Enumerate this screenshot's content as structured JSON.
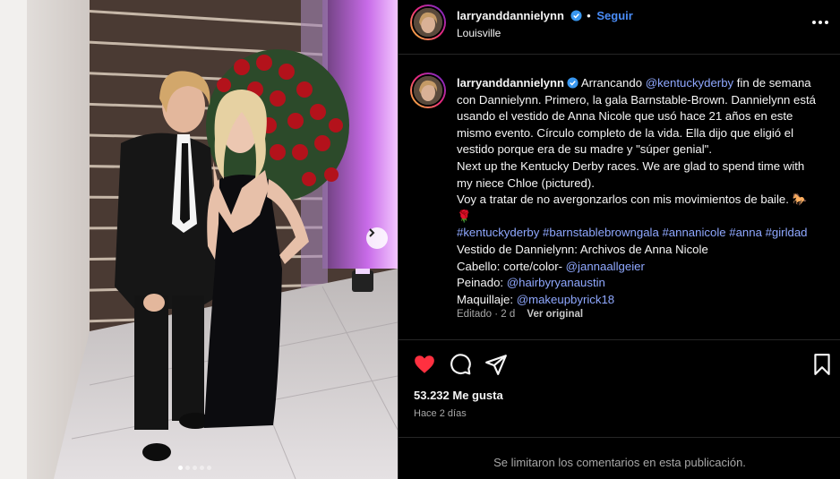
{
  "post": {
    "username": "larryanddannielynn",
    "follow_label": "Seguir",
    "location": "Louisville",
    "caption_lines": [
      [
        {
          "t": "larryanddannielynn",
          "c": "user"
        },
        {
          "t": "✓",
          "c": "verified"
        },
        {
          "t": " Arrancando ",
          "c": "text"
        },
        {
          "t": "@kentuckyderby",
          "c": "link"
        },
        {
          "t": " fin de semana",
          "c": "text"
        }
      ],
      [
        {
          "t": "con Dannielynn. Primero, la gala Barnstable-Brown. Dannielynn está",
          "c": "text"
        }
      ],
      [
        {
          "t": "usando el vestido de Anna Nicole que usó hace 21 años en este",
          "c": "text"
        }
      ],
      [
        {
          "t": "mismo evento. Círculo completo de la vida. Ella dijo que eligió el",
          "c": "text"
        }
      ],
      [
        {
          "t": "vestido porque era de su madre y \"súper genial\".",
          "c": "text"
        }
      ],
      [
        {
          "t": "Next up the Kentucky Derby races. We are glad to spend time with",
          "c": "text"
        }
      ],
      [
        {
          "t": "my niece Chloe (pictured).",
          "c": "text"
        }
      ],
      [
        {
          "t": "Voy a tratar de no avergonzarlos con mis movimientos de baile. 🐎",
          "c": "text"
        }
      ],
      [
        {
          "t": "🌹",
          "c": "text"
        }
      ],
      [
        {
          "t": "#kentuckyderby #barnstablebrowngala #annanicole #anna #girldad",
          "c": "link"
        }
      ],
      [
        {
          "t": "Vestido de Dannielynn: Archivos de Anna Nicole",
          "c": "text"
        }
      ],
      [
        {
          "t": "Cabello: corte/color- ",
          "c": "text"
        },
        {
          "t": "@jannaallgeier",
          "c": "link"
        }
      ],
      [
        {
          "t": "Peinado: ",
          "c": "text"
        },
        {
          "t": "@hairbyryanaustin",
          "c": "link"
        }
      ],
      [
        {
          "t": "Maquillaje: ",
          "c": "text"
        },
        {
          "t": "@makeupbyrick18",
          "c": "link"
        }
      ]
    ],
    "edited_label": "Editado · 2 d",
    "see_original_label": "Ver original",
    "likes": "53.232 Me gusta",
    "time_ago": "Hace 2 días",
    "comments_disabled": "Se limitaron los comentarios en esta publicación."
  },
  "carousel": {
    "count": 5,
    "active_index": 0
  },
  "colors": {
    "like_red": "#ff3040",
    "link": "#8fa8ff",
    "follow": "#4a8df8",
    "verified": "#3897f0"
  },
  "icons": [
    "heart-icon",
    "comment-icon",
    "share-icon",
    "bookmark-icon",
    "more-options-icon",
    "chevron-right-icon",
    "verified-icon"
  ]
}
